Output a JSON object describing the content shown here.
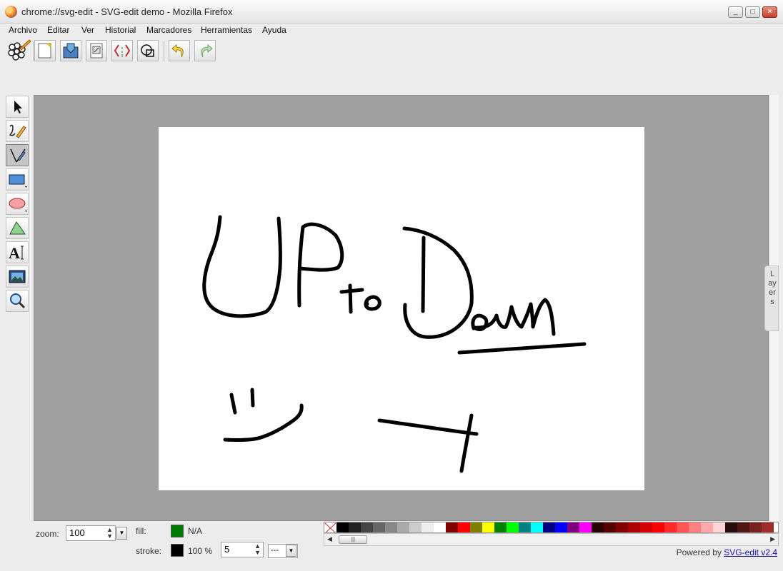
{
  "window": {
    "title": "chrome://svg-edit - SVG-edit demo - Mozilla Firefox",
    "minimize_label": "_",
    "maximize_label": "□",
    "close_label": "×"
  },
  "menu": [
    "Archivo",
    "Editar",
    "Ver",
    "Historial",
    "Marcadores",
    "Herramientas",
    "Ayuda"
  ],
  "toolbar": {
    "icons": [
      "svg-edit-logo-icon",
      "new-document-icon",
      "save-icon",
      "document-properties-icon",
      "source-code-icon",
      "wireframe-icon",
      "undo-icon",
      "redo-icon"
    ]
  },
  "left_tools": {
    "icons": [
      "select-arrow-icon",
      "freehand-pencil-icon",
      "path-pen-icon",
      "rectangle-icon",
      "ellipse-icon",
      "polygon-icon",
      "text-icon",
      "image-icon",
      "zoom-icon"
    ],
    "active": "path-pen-icon"
  },
  "layers": {
    "label": "Layers"
  },
  "bottom": {
    "zoom_label": "zoom:",
    "zoom_value": "100",
    "fill_label": "fill:",
    "fill_color": "#007b00",
    "fill_opacity": "N/A",
    "stroke_label": "stroke:",
    "stroke_color": "#000000",
    "stroke_opacity": "100 %",
    "stroke_width": "5",
    "stroke_dash": "---"
  },
  "palette": [
    "#000000",
    "#222222",
    "#444444",
    "#666666",
    "#888888",
    "#aaaaaa",
    "#cccccc",
    "#eeeeee",
    "#ffffff",
    "#800000",
    "#ff0000",
    "#808000",
    "#ffff00",
    "#008000",
    "#00ff00",
    "#008080",
    "#00ffff",
    "#000080",
    "#0000ff",
    "#800080",
    "#ff00ff",
    "#2b0000",
    "#550000",
    "#800000",
    "#aa0000",
    "#d40000",
    "#ff0000",
    "#ff2a2a",
    "#ff5555",
    "#ff8080",
    "#ffaaaa",
    "#ffd5d5",
    "#280b0b",
    "#501616",
    "#782121",
    "#a02c2c"
  ],
  "footer": {
    "powered_label": "Powered by",
    "powered_link": "SVG-edit v2.4"
  }
}
